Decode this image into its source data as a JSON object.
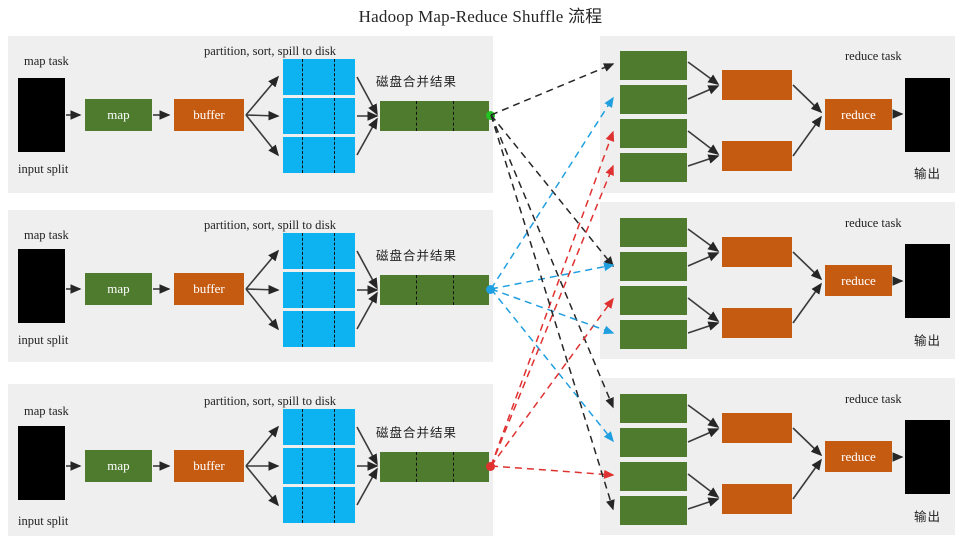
{
  "title": "Hadoop Map-Reduce Shuffle 流程",
  "labels": {
    "map_task": "map task",
    "input_split": "input split",
    "partition_sort_spill": "partition, sort, spill to disk",
    "disk_merge_result": "磁盘合并结果",
    "reduce_task": "reduce task",
    "output": "输出",
    "map": "map",
    "buffer": "buffer",
    "reduce": "reduce"
  },
  "colors": {
    "green": "#4e7b2e",
    "orange": "#c55a11",
    "cyan": "#0db2f0",
    "black": "#000000",
    "panel_bg": "#efefef",
    "page_bg": "#ffffff",
    "dot_green": "#22c322",
    "flow_black": "#262626",
    "flow_blue": "#1f9fe0",
    "flow_red": "#e03131"
  },
  "map_tasks": [
    {
      "index": 1,
      "map_task_label": "map task",
      "input_split_label": "input split",
      "spill_label": "partition, sort, spill to disk",
      "merge_label": "磁盘合并结果",
      "map_label": "map",
      "buffer_label": "buffer",
      "spill_count": 3,
      "flow_color": "#262626"
    },
    {
      "index": 2,
      "map_task_label": "map task",
      "input_split_label": "input split",
      "spill_label": "partition, sort, spill to disk",
      "merge_label": "磁盘合并结果",
      "map_label": "map",
      "buffer_label": "buffer",
      "spill_count": 3,
      "flow_color": "#1f9fe0"
    },
    {
      "index": 3,
      "map_task_label": "map task",
      "input_split_label": "input split",
      "spill_label": "partition, sort, spill to disk",
      "merge_label": "磁盘合并结果",
      "map_label": "map",
      "buffer_label": "buffer",
      "spill_count": 3,
      "flow_color": "#e03131"
    }
  ],
  "reduce_tasks": [
    {
      "index": 1,
      "reduce_task_label": "reduce task",
      "output_label": "输出",
      "reduce_label": "reduce",
      "copy_count": 4,
      "merge_count": 2,
      "incoming_colors": [
        "#262626",
        "#1f9fe0",
        "#e03131",
        "#e03131"
      ]
    },
    {
      "index": 2,
      "reduce_task_label": "reduce task",
      "output_label": "输出",
      "reduce_label": "reduce",
      "copy_count": 4,
      "merge_count": 2,
      "incoming_colors": [
        "#262626",
        "#1f9fe0",
        "#e03131",
        "#1f9fe0"
      ]
    },
    {
      "index": 3,
      "reduce_task_label": "reduce task",
      "output_label": "输出",
      "reduce_label": "reduce",
      "copy_count": 4,
      "merge_count": 2,
      "incoming_colors": [
        "#262626",
        "#1f9fe0",
        "#e03131",
        "#262626"
      ]
    }
  ]
}
